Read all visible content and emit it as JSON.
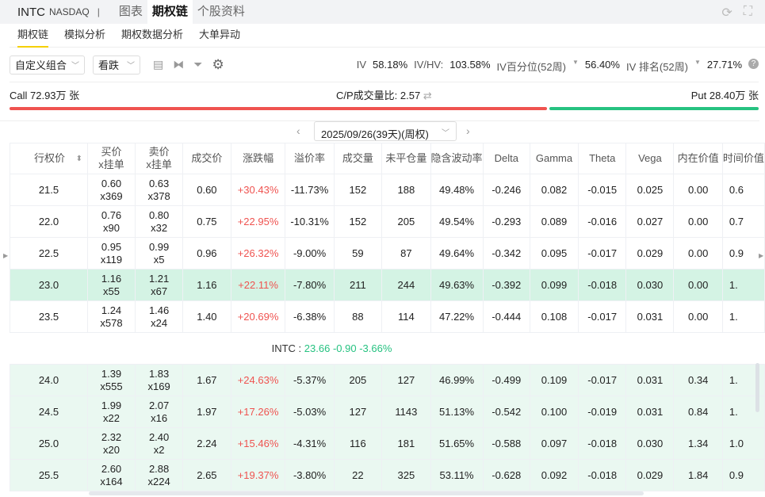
{
  "header": {
    "ticker": "INTC",
    "exchange": "NASDAQ",
    "separator": "|",
    "tabs": [
      "图表",
      "期权链",
      "个股资料"
    ],
    "active_tab": 1,
    "icons": [
      "refresh-icon",
      "fullscreen-icon"
    ]
  },
  "subnav": {
    "items": [
      "期权链",
      "模拟分析",
      "期权数据分析",
      "大单异动"
    ],
    "active": 0
  },
  "toolbar": {
    "combo_select": "自定义组合",
    "direction_select": "看跌",
    "icons": [
      "layout-icon",
      "compare-icon",
      "filter-icon",
      "gear-icon"
    ]
  },
  "iv": {
    "iv_label": "IV",
    "iv_value": "58.18%",
    "ivhv_label": "IV/HV:",
    "ivhv_value": "103.58%",
    "pct_label": "IV百分位(52周)",
    "pct_value": "56.40%",
    "rank_label": "IV 排名(52周)",
    "rank_value": "27.71%"
  },
  "cp": {
    "call": "Call 72.93万 张",
    "ratio": "C/P成交量比: 2.57",
    "put": "Put 28.40万 张",
    "call_share": 0.72,
    "colors": {
      "call": "#ef5350",
      "put": "#26c281"
    }
  },
  "expiry": {
    "selected": "2025/09/26(39天)(周权)"
  },
  "table": {
    "columns": [
      "行权价",
      "买价\nx挂单",
      "卖价\nx挂单",
      "成交价",
      "涨跌幅",
      "溢价率",
      "成交量",
      "未平仓量",
      "隐含波动率",
      "Delta",
      "Gamma",
      "Theta",
      "Vega",
      "内在价值",
      "时间价值"
    ],
    "rows_above": [
      {
        "strike": "21.5",
        "bid": "0.60",
        "bid_size": "x369",
        "ask": "0.63",
        "ask_size": "x378",
        "last": "0.60",
        "change": "+30.43%",
        "premium": "-11.73%",
        "volume": "152",
        "oi": "188",
        "iv": "49.48%",
        "delta": "-0.246",
        "gamma": "0.082",
        "theta": "-0.015",
        "vega": "0.025",
        "intrinsic": "0.00",
        "time_value": "0.6",
        "state": ""
      },
      {
        "strike": "22.0",
        "bid": "0.76",
        "bid_size": "x90",
        "ask": "0.80",
        "ask_size": "x32",
        "last": "0.75",
        "change": "+22.95%",
        "premium": "-10.31%",
        "volume": "152",
        "oi": "205",
        "iv": "49.54%",
        "delta": "-0.293",
        "gamma": "0.089",
        "theta": "-0.016",
        "vega": "0.027",
        "intrinsic": "0.00",
        "time_value": "0.7",
        "state": ""
      },
      {
        "strike": "22.5",
        "bid": "0.95",
        "bid_size": "x119",
        "ask": "0.99",
        "ask_size": "x5",
        "last": "0.96",
        "change": "+26.32%",
        "premium": "-9.00%",
        "volume": "59",
        "oi": "87",
        "iv": "49.64%",
        "delta": "-0.342",
        "gamma": "0.095",
        "theta": "-0.017",
        "vega": "0.029",
        "intrinsic": "0.00",
        "time_value": "0.9",
        "state": ""
      },
      {
        "strike": "23.0",
        "bid": "1.16",
        "bid_size": "x55",
        "ask": "1.21",
        "ask_size": "x67",
        "last": "1.16",
        "change": "+22.11%",
        "premium": "-7.80%",
        "volume": "211",
        "oi": "244",
        "iv": "49.63%",
        "delta": "-0.392",
        "gamma": "0.099",
        "theta": "-0.018",
        "vega": "0.030",
        "intrinsic": "0.00",
        "time_value": "1.",
        "state": "atm"
      },
      {
        "strike": "23.5",
        "bid": "1.24",
        "bid_size": "x578",
        "ask": "1.46",
        "ask_size": "x24",
        "last": "1.40",
        "change": "+20.69%",
        "premium": "-6.38%",
        "volume": "88",
        "oi": "114",
        "iv": "47.22%",
        "delta": "-0.444",
        "gamma": "0.108",
        "theta": "-0.017",
        "vega": "0.031",
        "intrinsic": "0.00",
        "time_value": "1.",
        "state": ""
      }
    ],
    "stock": {
      "label": "INTC :",
      "price": "23.66",
      "change": "-0.90",
      "change_pct": "-3.66%"
    },
    "rows_below": [
      {
        "strike": "24.0",
        "bid": "1.39",
        "bid_size": "x555",
        "ask": "1.83",
        "ask_size": "x169",
        "last": "1.67",
        "change": "+24.63%",
        "premium": "-5.37%",
        "volume": "205",
        "oi": "127",
        "iv": "46.99%",
        "delta": "-0.499",
        "gamma": "0.109",
        "theta": "-0.017",
        "vega": "0.031",
        "intrinsic": "0.34",
        "time_value": "1.",
        "state": "itm"
      },
      {
        "strike": "24.5",
        "bid": "1.99",
        "bid_size": "x22",
        "ask": "2.07",
        "ask_size": "x16",
        "last": "1.97",
        "change": "+17.26%",
        "premium": "-5.03%",
        "volume": "127",
        "oi": "1143",
        "iv": "51.13%",
        "delta": "-0.542",
        "gamma": "0.100",
        "theta": "-0.019",
        "vega": "0.031",
        "intrinsic": "0.84",
        "time_value": "1.",
        "state": "itm"
      },
      {
        "strike": "25.0",
        "bid": "2.32",
        "bid_size": "x20",
        "ask": "2.40",
        "ask_size": "x2",
        "last": "2.24",
        "change": "+15.46%",
        "premium": "-4.31%",
        "volume": "116",
        "oi": "181",
        "iv": "51.65%",
        "delta": "-0.588",
        "gamma": "0.097",
        "theta": "-0.018",
        "vega": "0.030",
        "intrinsic": "1.34",
        "time_value": "1.0",
        "state": "itm"
      },
      {
        "strike": "25.5",
        "bid": "2.60",
        "bid_size": "x164",
        "ask": "2.88",
        "ask_size": "x224",
        "last": "2.65",
        "change": "+19.37%",
        "premium": "-3.80%",
        "volume": "22",
        "oi": "325",
        "iv": "53.11%",
        "delta": "-0.628",
        "gamma": "0.092",
        "theta": "-0.018",
        "vega": "0.029",
        "intrinsic": "1.84",
        "time_value": "0.9",
        "state": "itm"
      }
    ]
  }
}
